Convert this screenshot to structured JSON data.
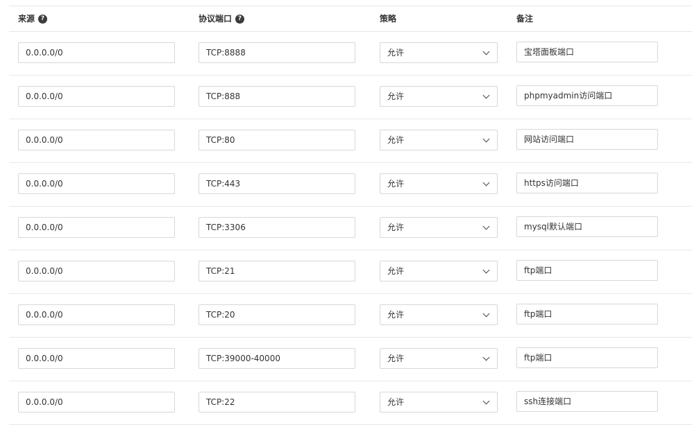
{
  "header": {
    "source": "来源",
    "protocol_port": "协议端口",
    "policy": "策略",
    "note": "备注",
    "help_glyph": "?"
  },
  "rows": [
    {
      "source": "0.0.0.0/0",
      "port": "TCP:8888",
      "policy": "允许",
      "note": "宝塔面板端口"
    },
    {
      "source": "0.0.0.0/0",
      "port": "TCP:888",
      "policy": "允许",
      "note": "phpmyadmin访问端口"
    },
    {
      "source": "0.0.0.0/0",
      "port": "TCP:80",
      "policy": "允许",
      "note": "网站访问端口"
    },
    {
      "source": "0.0.0.0/0",
      "port": "TCP:443",
      "policy": "允许",
      "note": "https访问端口"
    },
    {
      "source": "0.0.0.0/0",
      "port": "TCP:3306",
      "policy": "允许",
      "note": "mysql默认端口"
    },
    {
      "source": "0.0.0.0/0",
      "port": "TCP:21",
      "policy": "允许",
      "note": "ftp端口"
    },
    {
      "source": "0.0.0.0/0",
      "port": "TCP:20",
      "policy": "允许",
      "note": "ftp端口"
    },
    {
      "source": "0.0.0.0/0",
      "port": "TCP:39000-40000",
      "policy": "允许",
      "note": "ftp端口"
    },
    {
      "source": "0.0.0.0/0",
      "port": "TCP:22",
      "policy": "允许",
      "note": "ssh连接端口"
    }
  ]
}
